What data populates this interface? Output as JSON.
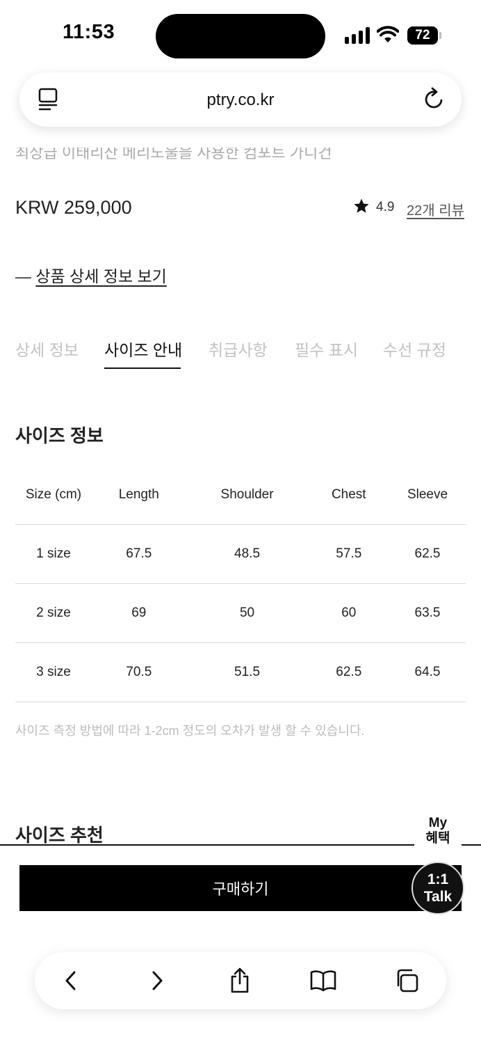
{
  "status_bar": {
    "time": "11:53",
    "battery": "72"
  },
  "browser": {
    "url": "ptry.co.kr"
  },
  "product": {
    "description": "최상급 이태리산 메리노울을 사용한 컴포트 가디건",
    "price": "KRW 259,000",
    "rating": "4.9",
    "reviews_link": "22개 리뷰",
    "detail_prefix": "—",
    "detail_link": "상품 상세 정보 보기"
  },
  "tabs": [
    {
      "label": "상세 정보",
      "active": false
    },
    {
      "label": "사이즈 안내",
      "active": true
    },
    {
      "label": "취급사항",
      "active": false
    },
    {
      "label": "필수 표시",
      "active": false
    },
    {
      "label": "수선 규정",
      "active": false
    }
  ],
  "size_info": {
    "title": "사이즈 정보",
    "headers": [
      "Size (cm)",
      "Length",
      "Shoulder",
      "Chest",
      "Sleeve"
    ],
    "rows": [
      [
        "1 size",
        "67.5",
        "48.5",
        "57.5",
        "62.5"
      ],
      [
        "2 size",
        "69",
        "50",
        "60",
        "63.5"
      ],
      [
        "3 size",
        "70.5",
        "51.5",
        "62.5",
        "64.5"
      ]
    ],
    "note": "사이즈 측정 방법에 따라 1-2cm 정도의 오차가 발생 할 수 있습니다."
  },
  "size_recommend": {
    "title": "사이즈 추천"
  },
  "floating": {
    "my_benefit_line1": "My",
    "my_benefit_line2": "혜택",
    "talk_line1": "1:1",
    "talk_line2": "Talk"
  },
  "buy_button": "구매하기",
  "toolbar_icons": [
    "back-icon",
    "forward-icon",
    "share-icon",
    "bookmarks-icon",
    "tabs-icon"
  ],
  "colors": {
    "accent": "#000000",
    "muted_text": "#c2c2c2",
    "divider": "#d8d8d8"
  }
}
